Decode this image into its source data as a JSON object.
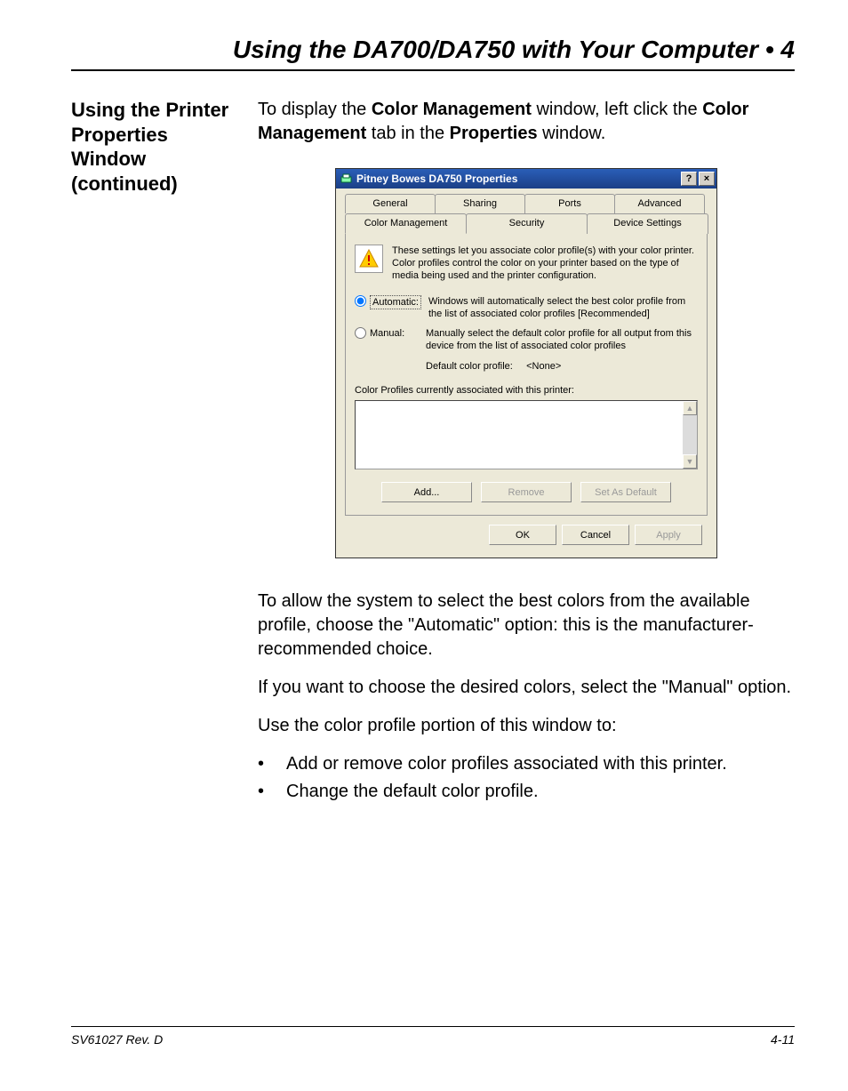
{
  "chapter_title": "Using the DA700/DA750 with Your Computer • 4",
  "sidebar_heading": "Using the Printer Properties Window (continued)",
  "intro": {
    "p1_a": "To display the ",
    "p1_b": "Color Management",
    "p1_c": " window, left click the ",
    "p1_d": "Color Management",
    "p1_e": " tab in the ",
    "p1_f": "Properties",
    "p1_g": " window."
  },
  "dialog": {
    "title": "Pitney Bowes DA750 Properties",
    "help_glyph": "?",
    "close_glyph": "×",
    "tabs_row1": [
      "General",
      "Sharing",
      "Ports",
      "Advanced"
    ],
    "tabs_row2": [
      "Color Management",
      "Security",
      "Device Settings"
    ],
    "info_text": "These settings let you associate color profile(s) with your color printer. Color profiles control the color on your printer based on the type of media being used and the printer configuration.",
    "radio_auto_label": "Automatic:",
    "radio_auto_desc": "Windows will automatically select the best color profile from the list of associated color profiles [Recommended]",
    "radio_manual_label": "Manual:",
    "radio_manual_desc": "Manually select the default color profile for all output from this device from the list of associated color profiles",
    "default_profile_label": "Default color profile:",
    "default_profile_value": "<None>",
    "profiles_list_label": "Color Profiles currently associated with this printer:",
    "btn_add": "Add...",
    "btn_remove": "Remove",
    "btn_setdefault": "Set As Default",
    "btn_ok": "OK",
    "btn_cancel": "Cancel",
    "btn_apply": "Apply"
  },
  "after": {
    "p1": "To allow the system to select the best colors from the available profile, choose the \"Automatic\" option: this is the manufacturer-recommended choice.",
    "p2": "If you want to choose the desired colors, select the \"Manual\" option.",
    "p3": "Use the color profile portion of this window to:",
    "bullets": [
      "Add or remove color profiles associated with this printer.",
      "Change the default color profile."
    ]
  },
  "footer": {
    "left": "SV61027 Rev. D",
    "right": "4-11"
  }
}
